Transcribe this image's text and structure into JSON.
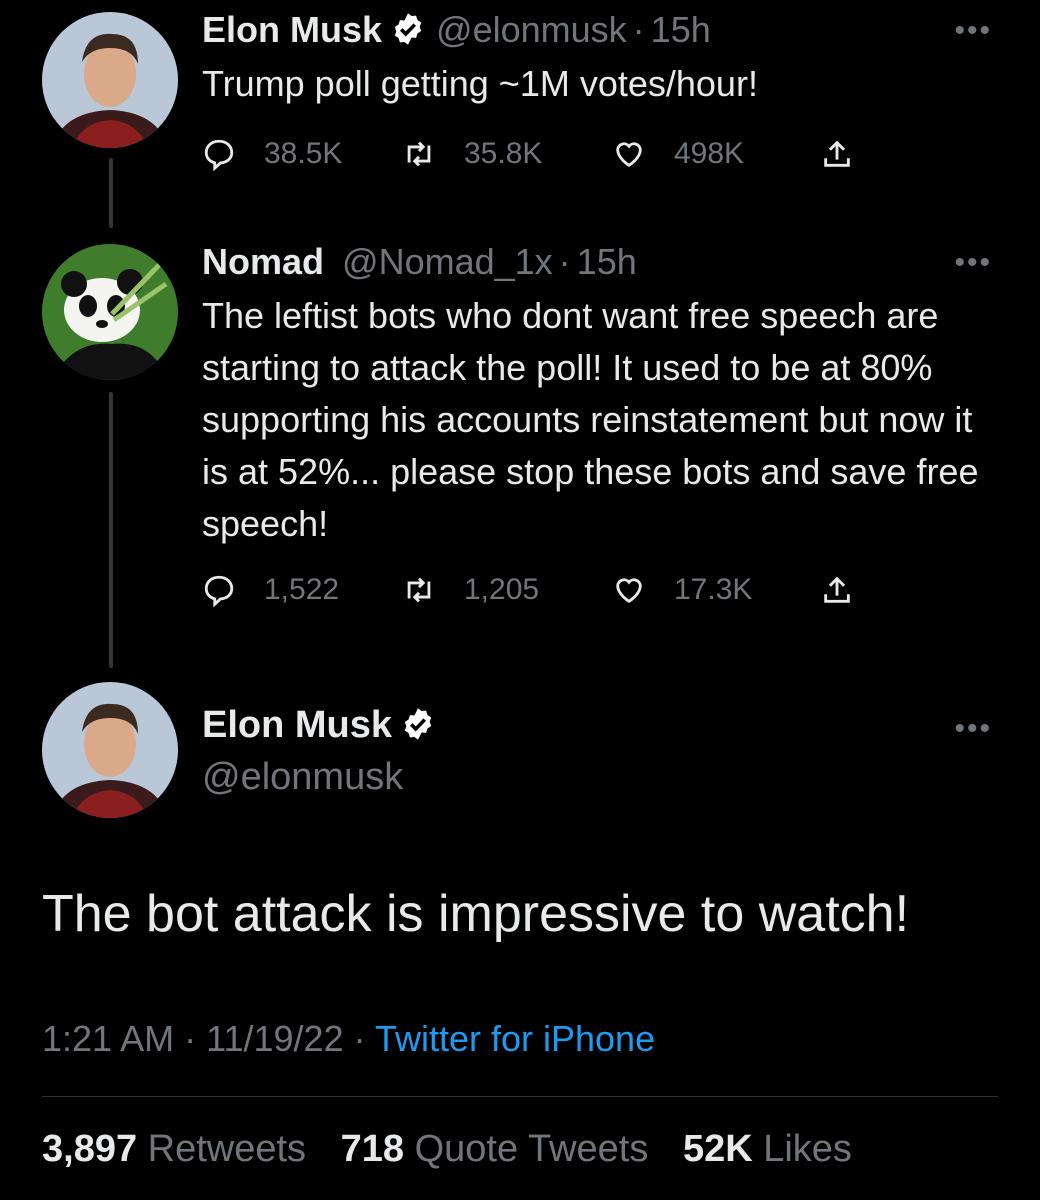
{
  "tweets": [
    {
      "name": "Elon Musk",
      "handle": "@elonmusk",
      "time": "15h",
      "verified": true,
      "text": "Trump poll getting ~1M votes/hour!",
      "replies": "38.5K",
      "retweets": "35.8K",
      "likes": "498K"
    },
    {
      "name": "Nomad",
      "handle": "@Nomad_1x",
      "time": "15h",
      "verified": false,
      "text": "The leftist bots who dont want free speech are starting to attack the poll! It used to be at 80% supporting his accounts reinstatement but now it is at 52%... please stop these bots and save free speech!",
      "replies": "1,522",
      "retweets": "1,205",
      "likes": "17.3K"
    }
  ],
  "focal": {
    "name": "Elon Musk",
    "handle": "@elonmusk",
    "verified": true,
    "text": "The bot attack is impressive to watch!",
    "time": "1:21 AM",
    "date": "11/19/22",
    "source": "Twitter for iPhone",
    "retweets_count": "3,897",
    "retweets_label": "Retweets",
    "quotes_count": "718",
    "quotes_label": "Quote Tweets",
    "likes_count": "52K",
    "likes_label": "Likes"
  },
  "separator": "·",
  "more_glyph": "•••",
  "colors": {
    "background": "#000000",
    "text": "#e7e9ea",
    "muted": "#71767b",
    "link": "#1d9bf0",
    "verified_badge": "#ffffff"
  },
  "icons": [
    "reply-icon",
    "retweet-icon",
    "like-icon",
    "share-icon",
    "verified-badge-icon",
    "more-icon"
  ]
}
